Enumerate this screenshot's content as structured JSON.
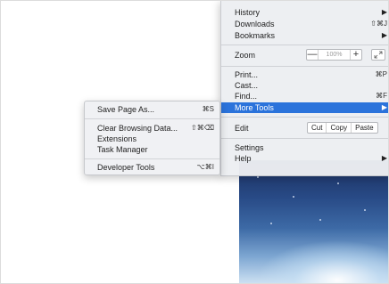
{
  "main_menu": {
    "items_top": [
      {
        "label": "History",
        "arrow": "▶"
      },
      {
        "label": "Downloads",
        "shortcut": "⇧⌘J"
      },
      {
        "label": "Bookmarks",
        "arrow": "▶"
      }
    ],
    "zoom": {
      "label": "Zoom",
      "minus": "—",
      "value": "100%",
      "plus": "+"
    },
    "items_mid": [
      {
        "label": "Print...",
        "shortcut": "⌘P"
      },
      {
        "label": "Cast..."
      },
      {
        "label": "Find...",
        "shortcut": "⌘F"
      },
      {
        "label": "More Tools",
        "arrow": "▶"
      }
    ],
    "edit": {
      "label": "Edit",
      "cut": "Cut",
      "copy": "Copy",
      "paste": "Paste"
    },
    "items_bottom": [
      {
        "label": "Settings"
      },
      {
        "label": "Help",
        "arrow": "▶"
      }
    ]
  },
  "submenu": {
    "items": [
      {
        "label": "Save Page As...",
        "shortcut": "⌘S"
      },
      {
        "label": "Clear Browsing Data...",
        "shortcut": "⇧⌘⌫"
      },
      {
        "label": "Extensions"
      },
      {
        "label": "Task Manager"
      },
      {
        "label": "Developer Tools",
        "shortcut": "⌥⌘I"
      }
    ]
  },
  "colors": {
    "highlight": "#2b73db",
    "menu_bg": "#eceef2"
  }
}
